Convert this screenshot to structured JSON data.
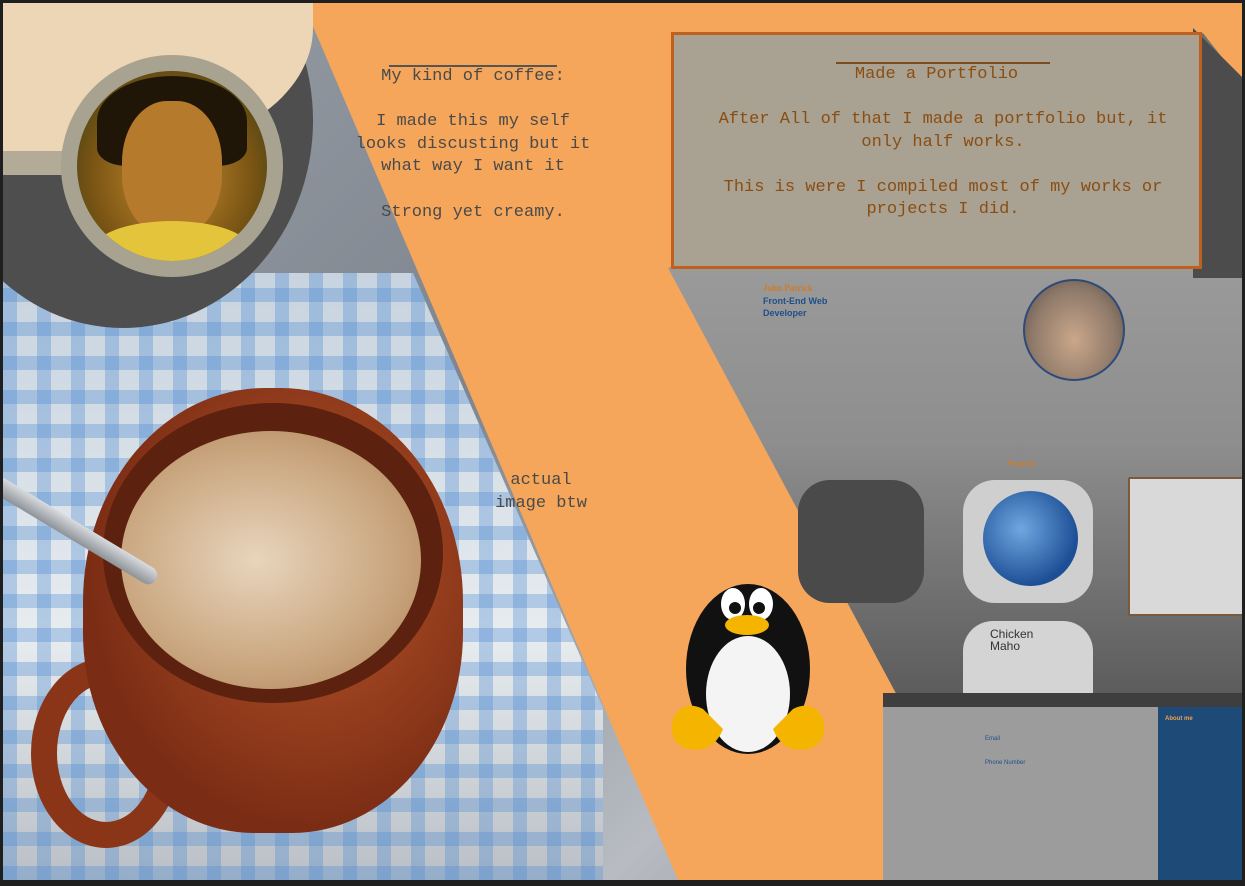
{
  "coffee": {
    "title": "My kind of coffee:",
    "body": "I made this my self\nlooks discusting but it\nwhat way I want it\n\nStrong yet creamy."
  },
  "photo_caption": "actual\nimage btw",
  "portfolio": {
    "title": "Made a Portfolio",
    "body": "After All of that I made a portfolio but, it\nonly half works.\n\nThis is were I compiled most of my works or\nprojects I did."
  },
  "screenshot": {
    "name": "John Patrick",
    "role": "Front-End Web Developer",
    "projects_heading": "Projects",
    "chicken_tile": "Chicken\nMaho",
    "email_label": "Email",
    "phone_label": "Phone Number",
    "about_heading": "About me"
  },
  "colors": {
    "background": "#f5a65a",
    "card": "#a9a191",
    "card_border": "#c0601e",
    "text": "#4a4a4a"
  }
}
